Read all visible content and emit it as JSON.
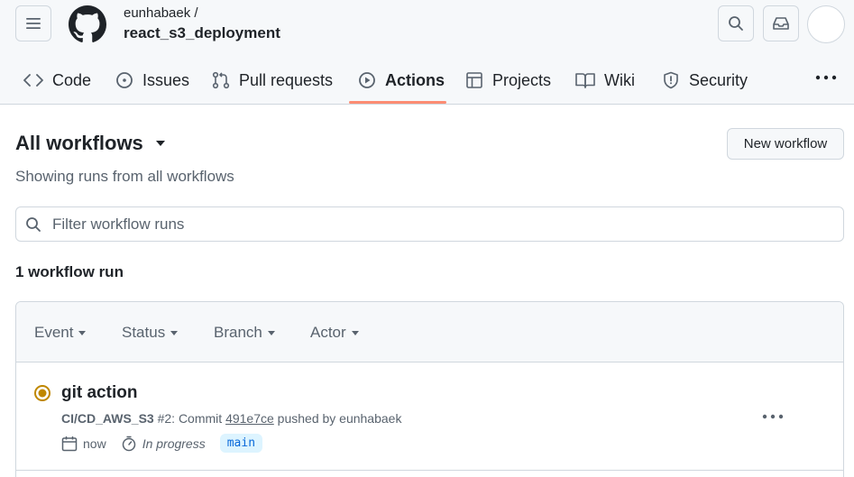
{
  "header": {
    "owner": "eunhabaek /",
    "repo": "react_s3_deployment"
  },
  "nav": {
    "tabs": [
      {
        "label": "Code",
        "icon": "code-icon"
      },
      {
        "label": "Issues",
        "icon": "issue-icon"
      },
      {
        "label": "Pull requests",
        "icon": "pull-request-icon"
      },
      {
        "label": "Actions",
        "icon": "play-icon",
        "active": true
      },
      {
        "label": "Projects",
        "icon": "table-icon"
      },
      {
        "label": "Wiki",
        "icon": "book-icon"
      },
      {
        "label": "Security",
        "icon": "shield-icon"
      }
    ]
  },
  "main": {
    "title": "All workflows",
    "new_workflow_label": "New workflow",
    "subtitle": "Showing runs from all workflows",
    "search_placeholder": "Filter workflow runs",
    "run_count": "1 workflow run",
    "filters": [
      "Event",
      "Status",
      "Branch",
      "Actor"
    ]
  },
  "runs": [
    {
      "title": "git action",
      "workflow": "CI/CD_AWS_S3",
      "meta_middle": " #2: Commit ",
      "commit": "491e7ce",
      "meta_end": " pushed by eunhabaek",
      "time": "now",
      "status": "In progress",
      "branch": "main",
      "status_color": "#bf8700"
    }
  ],
  "colors": {
    "accent_underline": "#fd8c73",
    "branch_bg": "#ddf4ff",
    "branch_fg": "#0969da",
    "in_progress": "#bf8700"
  }
}
